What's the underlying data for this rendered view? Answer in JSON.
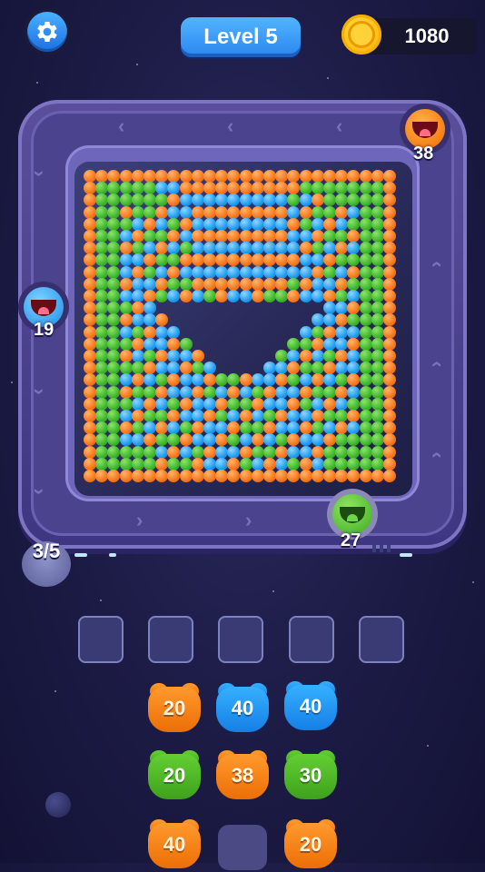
{
  "header": {
    "level_label": "Level 5",
    "coins": "1080"
  },
  "shooters": {
    "top_right": {
      "color": "orange",
      "count": "38"
    },
    "left": {
      "color": "blue",
      "count": "19"
    },
    "bottom_right": {
      "color": "green",
      "count": "27"
    }
  },
  "progress": {
    "label": "3/5"
  },
  "slots": {
    "count": 5,
    "filled": 0
  },
  "queue": [
    {
      "color": "orange",
      "count": "20"
    },
    {
      "color": "blue",
      "count": "40"
    },
    {
      "color": "blue",
      "count": "40"
    },
    {
      "color": "green",
      "count": "20"
    },
    {
      "color": "orange",
      "count": "38"
    },
    {
      "color": "green",
      "count": "30"
    },
    {
      "color": "orange",
      "count": "40"
    },
    {
      "color": "empty",
      "count": ""
    },
    {
      "color": "orange",
      "count": "20"
    }
  ],
  "colors": {
    "orange": "#f7761b",
    "green": "#3fb52d",
    "blue": "#1f9cf0",
    "accent": "#2a86ef",
    "coin": "#ffc21a"
  },
  "icons": {
    "settings": "gear-icon",
    "coin": "coin-icon",
    "direction": "chevron-icon"
  }
}
